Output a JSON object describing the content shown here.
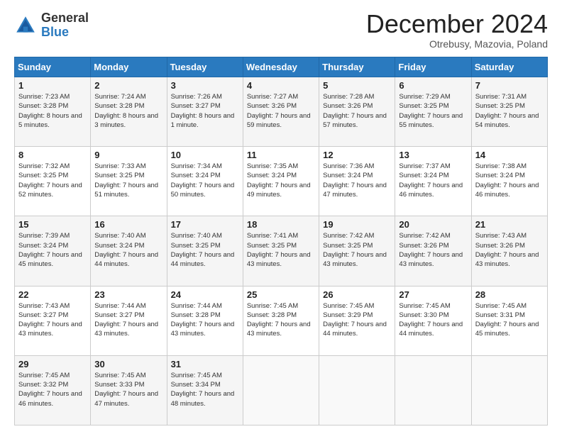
{
  "logo": {
    "general": "General",
    "blue": "Blue"
  },
  "title": "December 2024",
  "location": "Otrebusy, Mazovia, Poland",
  "days_of_week": [
    "Sunday",
    "Monday",
    "Tuesday",
    "Wednesday",
    "Thursday",
    "Friday",
    "Saturday"
  ],
  "weeks": [
    [
      {
        "day": "1",
        "sunrise": "Sunrise: 7:23 AM",
        "sunset": "Sunset: 3:28 PM",
        "daylight": "Daylight: 8 hours and 5 minutes."
      },
      {
        "day": "2",
        "sunrise": "Sunrise: 7:24 AM",
        "sunset": "Sunset: 3:28 PM",
        "daylight": "Daylight: 8 hours and 3 minutes."
      },
      {
        "day": "3",
        "sunrise": "Sunrise: 7:26 AM",
        "sunset": "Sunset: 3:27 PM",
        "daylight": "Daylight: 8 hours and 1 minute."
      },
      {
        "day": "4",
        "sunrise": "Sunrise: 7:27 AM",
        "sunset": "Sunset: 3:26 PM",
        "daylight": "Daylight: 7 hours and 59 minutes."
      },
      {
        "day": "5",
        "sunrise": "Sunrise: 7:28 AM",
        "sunset": "Sunset: 3:26 PM",
        "daylight": "Daylight: 7 hours and 57 minutes."
      },
      {
        "day": "6",
        "sunrise": "Sunrise: 7:29 AM",
        "sunset": "Sunset: 3:25 PM",
        "daylight": "Daylight: 7 hours and 55 minutes."
      },
      {
        "day": "7",
        "sunrise": "Sunrise: 7:31 AM",
        "sunset": "Sunset: 3:25 PM",
        "daylight": "Daylight: 7 hours and 54 minutes."
      }
    ],
    [
      {
        "day": "8",
        "sunrise": "Sunrise: 7:32 AM",
        "sunset": "Sunset: 3:25 PM",
        "daylight": "Daylight: 7 hours and 52 minutes."
      },
      {
        "day": "9",
        "sunrise": "Sunrise: 7:33 AM",
        "sunset": "Sunset: 3:25 PM",
        "daylight": "Daylight: 7 hours and 51 minutes."
      },
      {
        "day": "10",
        "sunrise": "Sunrise: 7:34 AM",
        "sunset": "Sunset: 3:24 PM",
        "daylight": "Daylight: 7 hours and 50 minutes."
      },
      {
        "day": "11",
        "sunrise": "Sunrise: 7:35 AM",
        "sunset": "Sunset: 3:24 PM",
        "daylight": "Daylight: 7 hours and 49 minutes."
      },
      {
        "day": "12",
        "sunrise": "Sunrise: 7:36 AM",
        "sunset": "Sunset: 3:24 PM",
        "daylight": "Daylight: 7 hours and 47 minutes."
      },
      {
        "day": "13",
        "sunrise": "Sunrise: 7:37 AM",
        "sunset": "Sunset: 3:24 PM",
        "daylight": "Daylight: 7 hours and 46 minutes."
      },
      {
        "day": "14",
        "sunrise": "Sunrise: 7:38 AM",
        "sunset": "Sunset: 3:24 PM",
        "daylight": "Daylight: 7 hours and 46 minutes."
      }
    ],
    [
      {
        "day": "15",
        "sunrise": "Sunrise: 7:39 AM",
        "sunset": "Sunset: 3:24 PM",
        "daylight": "Daylight: 7 hours and 45 minutes."
      },
      {
        "day": "16",
        "sunrise": "Sunrise: 7:40 AM",
        "sunset": "Sunset: 3:24 PM",
        "daylight": "Daylight: 7 hours and 44 minutes."
      },
      {
        "day": "17",
        "sunrise": "Sunrise: 7:40 AM",
        "sunset": "Sunset: 3:25 PM",
        "daylight": "Daylight: 7 hours and 44 minutes."
      },
      {
        "day": "18",
        "sunrise": "Sunrise: 7:41 AM",
        "sunset": "Sunset: 3:25 PM",
        "daylight": "Daylight: 7 hours and 43 minutes."
      },
      {
        "day": "19",
        "sunrise": "Sunrise: 7:42 AM",
        "sunset": "Sunset: 3:25 PM",
        "daylight": "Daylight: 7 hours and 43 minutes."
      },
      {
        "day": "20",
        "sunrise": "Sunrise: 7:42 AM",
        "sunset": "Sunset: 3:26 PM",
        "daylight": "Daylight: 7 hours and 43 minutes."
      },
      {
        "day": "21",
        "sunrise": "Sunrise: 7:43 AM",
        "sunset": "Sunset: 3:26 PM",
        "daylight": "Daylight: 7 hours and 43 minutes."
      }
    ],
    [
      {
        "day": "22",
        "sunrise": "Sunrise: 7:43 AM",
        "sunset": "Sunset: 3:27 PM",
        "daylight": "Daylight: 7 hours and 43 minutes."
      },
      {
        "day": "23",
        "sunrise": "Sunrise: 7:44 AM",
        "sunset": "Sunset: 3:27 PM",
        "daylight": "Daylight: 7 hours and 43 minutes."
      },
      {
        "day": "24",
        "sunrise": "Sunrise: 7:44 AM",
        "sunset": "Sunset: 3:28 PM",
        "daylight": "Daylight: 7 hours and 43 minutes."
      },
      {
        "day": "25",
        "sunrise": "Sunrise: 7:45 AM",
        "sunset": "Sunset: 3:28 PM",
        "daylight": "Daylight: 7 hours and 43 minutes."
      },
      {
        "day": "26",
        "sunrise": "Sunrise: 7:45 AM",
        "sunset": "Sunset: 3:29 PM",
        "daylight": "Daylight: 7 hours and 44 minutes."
      },
      {
        "day": "27",
        "sunrise": "Sunrise: 7:45 AM",
        "sunset": "Sunset: 3:30 PM",
        "daylight": "Daylight: 7 hours and 44 minutes."
      },
      {
        "day": "28",
        "sunrise": "Sunrise: 7:45 AM",
        "sunset": "Sunset: 3:31 PM",
        "daylight": "Daylight: 7 hours and 45 minutes."
      }
    ],
    [
      {
        "day": "29",
        "sunrise": "Sunrise: 7:45 AM",
        "sunset": "Sunset: 3:32 PM",
        "daylight": "Daylight: 7 hours and 46 minutes."
      },
      {
        "day": "30",
        "sunrise": "Sunrise: 7:45 AM",
        "sunset": "Sunset: 3:33 PM",
        "daylight": "Daylight: 7 hours and 47 minutes."
      },
      {
        "day": "31",
        "sunrise": "Sunrise: 7:45 AM",
        "sunset": "Sunset: 3:34 PM",
        "daylight": "Daylight: 7 hours and 48 minutes."
      },
      null,
      null,
      null,
      null
    ]
  ]
}
